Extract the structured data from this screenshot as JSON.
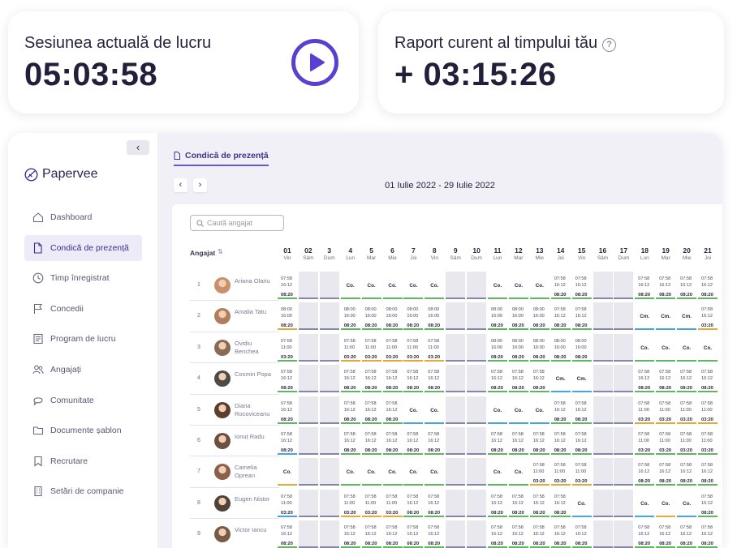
{
  "session": {
    "title": "Sesiunea actuală de lucru",
    "value": "05:03:58"
  },
  "report": {
    "title": "Raport curent al timpului tău",
    "value": "+ 03:15:26",
    "help": "?"
  },
  "sidebar": {
    "collapse": "‹",
    "logo": "Papervee",
    "items": [
      {
        "label": "Dashboard",
        "icon": "home-icon"
      },
      {
        "label": "Condică de prezență",
        "icon": "document-icon",
        "active": true
      },
      {
        "label": "Timp înregistrat",
        "icon": "clock-icon"
      },
      {
        "label": "Concedii",
        "icon": "flag-icon"
      },
      {
        "label": "Program de lucru",
        "icon": "schedule-icon"
      },
      {
        "label": "Angajați",
        "icon": "users-icon"
      },
      {
        "label": "Comunitate",
        "icon": "chat-icon"
      },
      {
        "label": "Documente șablon",
        "icon": "folder-icon"
      },
      {
        "label": "Recrutare",
        "icon": "bookmark-icon"
      },
      {
        "label": "Setări de companie",
        "icon": "building-icon"
      }
    ]
  },
  "main": {
    "tab": "Condică de prezență",
    "prev": "‹",
    "next": "›",
    "range": "01 Iulie 2022 - 29 Iulie 2022",
    "search_placeholder": "Caută angajat",
    "employee_header": "Angajat",
    "sort": "⇅",
    "days": [
      {
        "n": "01",
        "d": "Vin"
      },
      {
        "n": "02",
        "d": "Sâm"
      },
      {
        "n": "3",
        "d": "Dum"
      },
      {
        "n": "4",
        "d": "Lun"
      },
      {
        "n": "5",
        "d": "Mar"
      },
      {
        "n": "6",
        "d": "Mie"
      },
      {
        "n": "7",
        "d": "Joi"
      },
      {
        "n": "8",
        "d": "Vin"
      },
      {
        "n": "9",
        "d": "Sâm"
      },
      {
        "n": "10",
        "d": "Dum"
      },
      {
        "n": "11",
        "d": "Lun"
      },
      {
        "n": "12",
        "d": "Mar"
      },
      {
        "n": "13",
        "d": "Mie"
      },
      {
        "n": "14",
        "d": "Joi"
      },
      {
        "n": "15",
        "d": "Vin"
      },
      {
        "n": "16",
        "d": "Sâm"
      },
      {
        "n": "17",
        "d": "Dum"
      },
      {
        "n": "18",
        "d": "Lun"
      },
      {
        "n": "19",
        "d": "Mar"
      },
      {
        "n": "20",
        "d": "Mie"
      },
      {
        "n": "21",
        "d": "Joi"
      }
    ],
    "employees": [
      {
        "num": "1",
        "name": "Ariana Olariu",
        "avatar": "#c9906b",
        "cells": [
          "07:58|16:12|08:20",
          "W",
          "W",
          "Co.",
          "Co.",
          "Co.",
          "Co.",
          "Co.",
          "W",
          "W",
          "Co.",
          "Co.",
          "Co.",
          "07:58|16:12|08:20",
          "07:58|16:12|08:20",
          "W",
          "W",
          "07:58|16:12|08:20",
          "07:58|16:12|08:20",
          "07:58|16:12|08:20",
          "07:58|16:12|08:20"
        ],
        "bars": [
          "g",
          "p",
          "p",
          "g",
          "g",
          "g",
          "g",
          "g",
          "p",
          "p",
          "g",
          "g",
          "g",
          "g",
          "g",
          "p",
          "p",
          "g",
          "g",
          "g",
          "g"
        ]
      },
      {
        "num": "2",
        "name": "Amalia Tatu",
        "avatar": "#b07e5e",
        "cells": [
          "08:00|16:00|08:20",
          "W",
          "W",
          "08:00|16:00|08:20",
          "08:00|16:00|08:20",
          "08:00|16:00|08:20",
          "08:00|16:00|08:20",
          "08:00|16:00|08:20",
          "W",
          "W",
          "08:00|16:00|08:20",
          "08:00|16:00|08:20",
          "08:00|16:00|08:20",
          "07:58|16:12|08:20",
          "07:58|16:12|08:20",
          "W",
          "W",
          "Cm.",
          "Cm.",
          "Cm.",
          "07:58|16:12|03:20"
        ],
        "bars": [
          "o",
          "p",
          "p",
          "g",
          "g",
          "g",
          "g",
          "g",
          "p",
          "p",
          "g",
          "g",
          "g",
          "g",
          "g",
          "p",
          "p",
          "b",
          "b",
          "b",
          "o"
        ]
      },
      {
        "num": "3",
        "name": "Ovidiu Benchea",
        "avatar": "#8a6a52",
        "cells": [
          "07:58|11:00|03:20",
          "W",
          "W",
          "07:58|11:00|03:20",
          "07:58|11:00|03:20",
          "07:58|11:00|03:20",
          "07:58|11:00|03:20",
          "07:58|11:00|03:20",
          "W",
          "W",
          "08:00|16:00|08:20",
          "08:00|16:00|08:20",
          "08:00|16:00|08:20",
          "08:00|16:00|08:20",
          "08:00|16:00|08:20",
          "W",
          "W",
          "Co.",
          "Co.",
          "Co.",
          "Co."
        ],
        "bars": [
          "g",
          "p",
          "p",
          "o",
          "o",
          "o",
          "o",
          "o",
          "p",
          "p",
          "g",
          "g",
          "g",
          "g",
          "g",
          "p",
          "p",
          "g",
          "g",
          "g",
          "g"
        ]
      },
      {
        "num": "4",
        "name": "Cosmin Popa",
        "avatar": "#4e4a44",
        "cells": [
          "07:58|16:12|08:20",
          "W",
          "W",
          "07:58|16:12|08:20",
          "07:58|16:12|08:20",
          "07:58|16:12|08:20",
          "07:58|16:12|08:20",
          "07:58|16:12|08:20",
          "W",
          "W",
          "07:58|16:12|08:20",
          "07:58|16:12|08:20",
          "07:58|16:12|08:20",
          "Cm.",
          "Cm.",
          "W",
          "W",
          "07:58|16:12|08:20",
          "07:58|16:12|08:20",
          "07:58|16:12|08:20",
          "07:58|16:12|08:20"
        ],
        "bars": [
          "g",
          "p",
          "p",
          "g",
          "g",
          "g",
          "g",
          "g",
          "p",
          "p",
          "g",
          "g",
          "g",
          "b",
          "b",
          "p",
          "p",
          "g",
          "g",
          "g",
          "g"
        ]
      },
      {
        "num": "5",
        "name": "Diana Rocoviceanu",
        "avatar": "#5d3d2e",
        "cells": [
          "07:58|16:12|08:20",
          "W",
          "W",
          "07:58|16:12|08:20",
          "07:58|16:12|08:20",
          "07:58|16:12|08:20",
          "Co.",
          "Co.",
          "W",
          "W",
          "Co.",
          "Co.",
          "Co.",
          "07:58|16:12|08:20",
          "07:58|16:12|08:20",
          "W",
          "W",
          "07:58|11:00|03:20",
          "07:58|11:00|03:20",
          "07:58|11:00|03:20",
          "07:58|11:00|03:20"
        ],
        "bars": [
          "g",
          "p",
          "p",
          "g",
          "g",
          "g",
          "b",
          "b",
          "p",
          "p",
          "b",
          "b",
          "b",
          "g",
          "g",
          "p",
          "p",
          "o",
          "o",
          "o",
          "o"
        ]
      },
      {
        "num": "6",
        "name": "Ionuț Radu",
        "avatar": "#6d4f3e",
        "cells": [
          "07:58|16:12|08:20",
          "W",
          "W",
          "07:58|16:12|08:20",
          "07:58|16:12|08:20",
          "07:58|16:12|08:20",
          "07:58|16:12|08:20",
          "07:58|16:12|08:20",
          "W",
          "W",
          "07:58|16:12|08:20",
          "07:58|16:12|08:20",
          "07:58|16:12|08:20",
          "07:58|16:12|08:20",
          "07:58|16:12|08:20",
          "W",
          "W",
          "07:58|11:00|03:20",
          "07:58|11:00|03:20",
          "07:58|11:00|03:20",
          "07:58|11:00|03:20"
        ],
        "bars": [
          "b",
          "p",
          "p",
          "g",
          "g",
          "g",
          "g",
          "g",
          "p",
          "p",
          "g",
          "g",
          "g",
          "g",
          "g",
          "p",
          "p",
          "g",
          "g",
          "g",
          "g"
        ]
      },
      {
        "num": "7",
        "name": "Camelia Oprean",
        "avatar": "#8b6048",
        "cells": [
          "Co.",
          "W",
          "W",
          "Co.",
          "Co.",
          "Co.",
          "Co.",
          "Co.",
          "W",
          "W",
          "Co.",
          "Co.",
          "07:58|11:00|03:20",
          "07:58|11:00|03:20",
          "07:58|11:00|03:20",
          "W",
          "W",
          "07:58|16:12|08:20",
          "07:58|16:12|08:20",
          "07:58|16:12|08:20",
          "07:58|16:12|08:20"
        ],
        "bars": [
          "o",
          "p",
          "p",
          "g",
          "g",
          "g",
          "g",
          "g",
          "p",
          "p",
          "g",
          "g",
          "o",
          "o",
          "o",
          "p",
          "p",
          "g",
          "g",
          "g",
          "g"
        ]
      },
      {
        "num": "8",
        "name": "Eugen Nistor",
        "avatar": "#4f4338",
        "cells": [
          "07:58|11:00|03:20",
          "W",
          "W",
          "07:58|11:00|03:20",
          "07:58|11:00|03:20",
          "07:58|11:00|03:20",
          "07:58|16:12|08:20",
          "07:58|16:12|08:20",
          "W",
          "W",
          "07:58|16:12|08:20",
          "07:58|16:12|08:20",
          "07:58|16:12|08:20",
          "07:58|16:12|08:20",
          "Co.",
          "W",
          "W",
          "Co.",
          "Co.",
          "Co.",
          "07:58|16:12|08:20"
        ],
        "bars": [
          "b",
          "p",
          "p",
          "o",
          "o",
          "o",
          "g",
          "g",
          "p",
          "p",
          "g",
          "g",
          "g",
          "g",
          "b",
          "p",
          "p",
          "b",
          "o",
          "b",
          "g"
        ]
      },
      {
        "num": "9",
        "name": "Victor Iancu",
        "avatar": "#7a5a45",
        "cells": [
          "07:58|16:12|08:20",
          "W",
          "W",
          "07:58|16:12|08:20",
          "07:58|16:12|08:20",
          "07:58|16:12|08:20",
          "07:58|16:12|08:20",
          "07:58|16:12|08:20",
          "W",
          "W",
          "07:58|16:12|08:20",
          "07:58|16:12|08:20",
          "07:58|16:12|08:20",
          "07:58|16:12|08:20",
          "07:58|16:12|08:20",
          "W",
          "W",
          "07:58|16:12|08:20",
          "07:58|16:12|08:20",
          "07:58|16:12|08:20",
          "07:58|16:12|08:20"
        ],
        "bars": [
          "g",
          "p",
          "p",
          "g",
          "g",
          "g",
          "g",
          "g",
          "p",
          "p",
          "g",
          "g",
          "g",
          "g",
          "g",
          "p",
          "p",
          "g",
          "g",
          "g",
          "g"
        ]
      }
    ],
    "bar_colors": {
      "g": "#5cb85c",
      "p": "#8585a8",
      "o": "#e7a835",
      "b": "#43a6e0"
    }
  }
}
